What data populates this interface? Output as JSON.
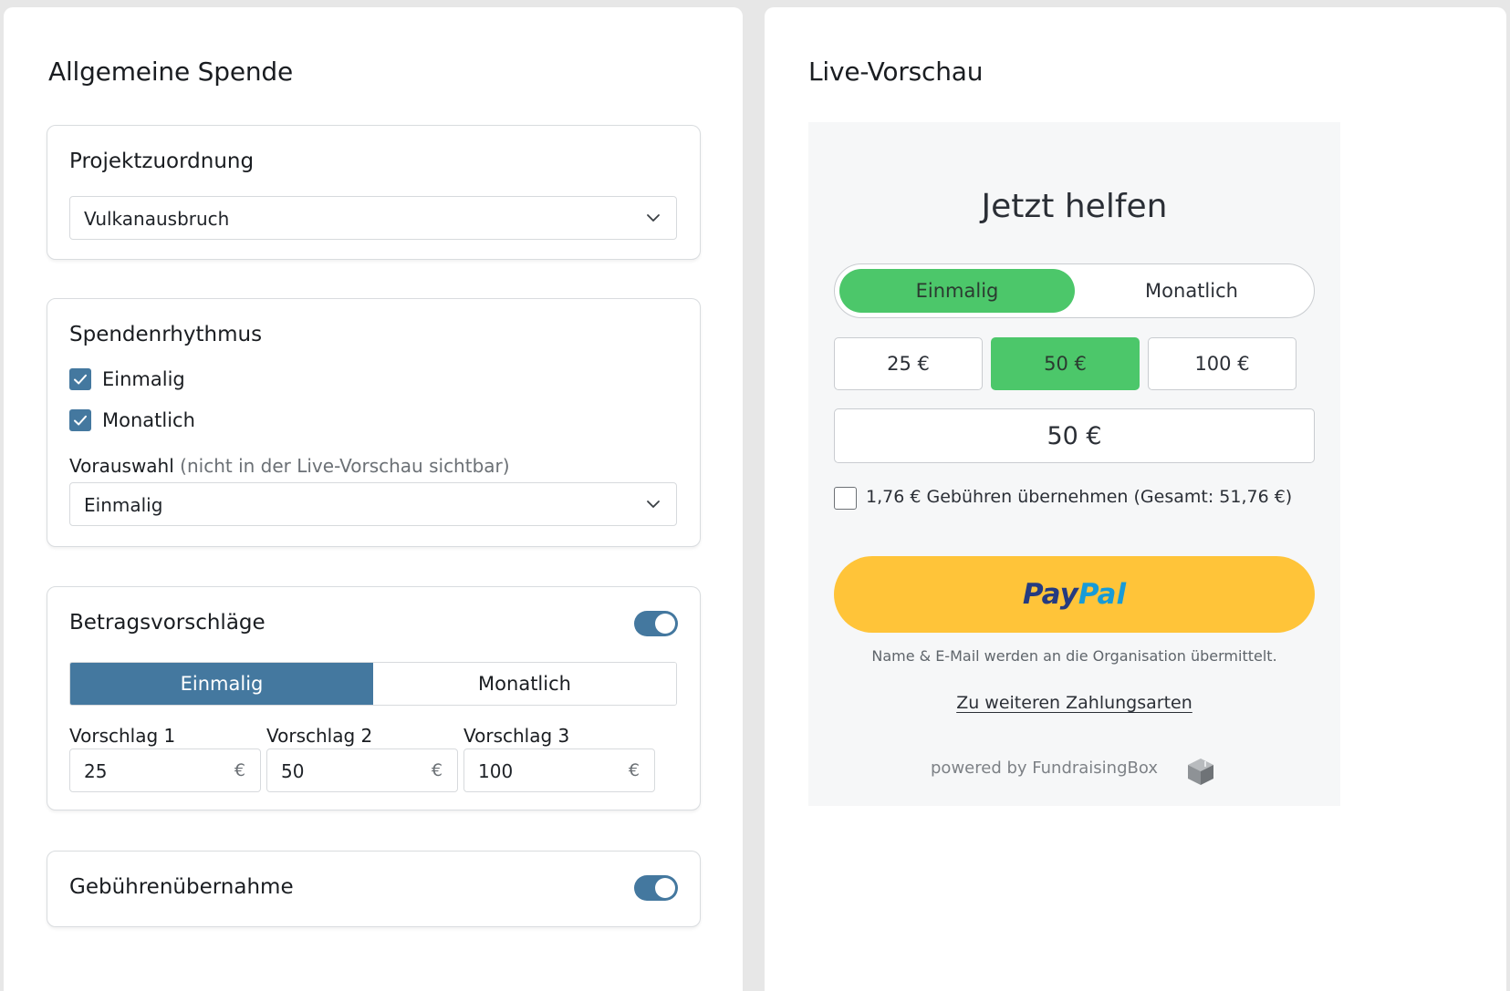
{
  "left": {
    "title": "Allgemeine Spende",
    "project": {
      "title": "Projektzuordnung",
      "selected": "Vulkanausbruch"
    },
    "rhythm": {
      "title": "Spendenrhythmus",
      "options": [
        "Einmalig",
        "Monatlich"
      ],
      "preselect_label": "Vorauswahl",
      "preselect_hint": "(nicht in der Live-Vorschau sichtbar)",
      "preselect_value": "Einmalig"
    },
    "suggestions": {
      "title": "Betragsvorschläge",
      "enabled": true,
      "tabs": [
        "Einmalig",
        "Monatlich"
      ],
      "active_tab": "Einmalig",
      "labels": [
        "Vorschlag 1",
        "Vorschlag 2",
        "Vorschlag 3"
      ],
      "values": [
        "25",
        "50",
        "100"
      ],
      "currency": "€"
    },
    "fees": {
      "title": "Gebührenübernahme",
      "enabled": true
    }
  },
  "right": {
    "title": "Live-Vorschau",
    "heading": "Jetzt helfen",
    "frequency": [
      "Einmalig",
      "Monatlich"
    ],
    "amounts": [
      "25 €",
      "50 €",
      "100 €"
    ],
    "selected_amount": "50 €",
    "custom_amount": "50 €",
    "fee_text": "1,76 € Gebühren übernehmen (Gesamt: 51,76 €)",
    "paypal": {
      "pay": "Pay",
      "pal": "Pal"
    },
    "privacy_note": "Name & E-Mail werden an die Organisation übermittelt.",
    "more_payments": "Zu weiteren Zahlungsarten",
    "powered_by": "powered by FundraisingBox"
  },
  "colors": {
    "accent": "#44789f",
    "green": "#4cc76a",
    "paypal_yellow": "#ffc439",
    "paypal_dark": "#253b80",
    "paypal_light": "#179bd7"
  },
  "icons": [
    "chevron-down-icon",
    "checkmark-icon",
    "box-logo-icon"
  ]
}
